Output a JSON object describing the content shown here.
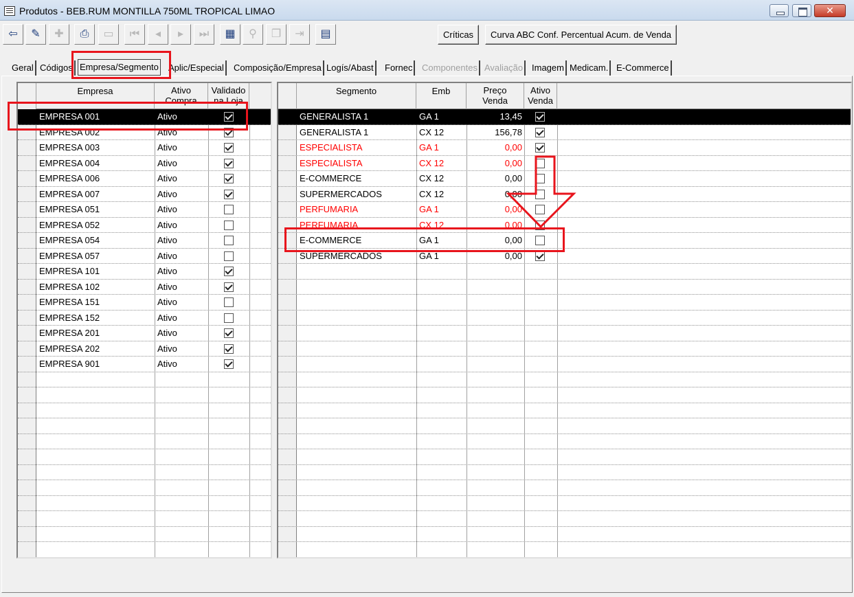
{
  "window": {
    "title": "Produtos - BEB.RUM MONTILLA 750ML TROPICAL LIMAO",
    "close_glyph": "✕"
  },
  "toolbar": {
    "icons": [
      {
        "name": "exit-icon",
        "glyph": "⇦",
        "enabled": true
      },
      {
        "name": "edit-icon",
        "glyph": "✎",
        "enabled": true
      },
      {
        "name": "new-record-icon",
        "glyph": "✚",
        "enabled": false
      },
      {
        "name": "print-icon",
        "glyph": "⎙",
        "enabled": true
      },
      {
        "name": "delete-icon",
        "glyph": "▭",
        "enabled": false
      },
      {
        "name": "first-record-icon",
        "glyph": "⏮",
        "enabled": false
      },
      {
        "name": "prev-record-icon",
        "glyph": "◂",
        "enabled": false
      },
      {
        "name": "next-record-icon",
        "glyph": "▸",
        "enabled": false
      },
      {
        "name": "last-record-icon",
        "glyph": "⏭",
        "enabled": false
      },
      {
        "name": "list-view-icon",
        "glyph": "▦",
        "enabled": true
      },
      {
        "name": "find-icon",
        "glyph": "⚲",
        "enabled": false
      },
      {
        "name": "copy-icon",
        "glyph": "❐",
        "enabled": false
      },
      {
        "name": "export-icon",
        "glyph": "⇥",
        "enabled": false
      },
      {
        "name": "grid-config-icon",
        "glyph": "▤",
        "enabled": true
      }
    ],
    "criticas_label": "Críticas",
    "curva_label": "Curva ABC Conf. Percentual Acum. de Venda"
  },
  "tabs": [
    {
      "label": "Geral",
      "state": "normal"
    },
    {
      "label": "Códigos",
      "state": "normal"
    },
    {
      "label": "Empresa/Segmento",
      "state": "active"
    },
    {
      "label": "Aplic/Especial",
      "state": "normal"
    },
    {
      "label": "Composição/Empresa",
      "state": "normal"
    },
    {
      "label": "Logís/Abast",
      "state": "normal"
    },
    {
      "label": "Fornec",
      "state": "normal"
    },
    {
      "label": "Componentes",
      "state": "disabled"
    },
    {
      "label": "Avaliação",
      "state": "disabled"
    },
    {
      "label": "Imagem",
      "state": "normal"
    },
    {
      "label": "Medicam.",
      "state": "normal"
    },
    {
      "label": "E-Commerce",
      "state": "normal"
    }
  ],
  "empresa_grid": {
    "headers": {
      "empresa": "Empresa",
      "ativo_compra": "Ativo\nCompra",
      "validado": "Validado\nna Loja"
    },
    "rows": [
      {
        "empresa": "EMPRESA 001",
        "ativo": "Ativo",
        "validado": true,
        "selected": true
      },
      {
        "empresa": "EMPRESA 002",
        "ativo": "Ativo",
        "validado": true
      },
      {
        "empresa": "EMPRESA 003",
        "ativo": "Ativo",
        "validado": true
      },
      {
        "empresa": "EMPRESA 004",
        "ativo": "Ativo",
        "validado": true
      },
      {
        "empresa": "EMPRESA 006",
        "ativo": "Ativo",
        "validado": true
      },
      {
        "empresa": "EMPRESA 007",
        "ativo": "Ativo",
        "validado": true
      },
      {
        "empresa": "EMPRESA 051",
        "ativo": "Ativo",
        "validado": false
      },
      {
        "empresa": "EMPRESA 052",
        "ativo": "Ativo",
        "validado": false
      },
      {
        "empresa": "EMPRESA 054",
        "ativo": "Ativo",
        "validado": false
      },
      {
        "empresa": "EMPRESA 057",
        "ativo": "Ativo",
        "validado": false
      },
      {
        "empresa": "EMPRESA 101",
        "ativo": "Ativo",
        "validado": true
      },
      {
        "empresa": "EMPRESA 102",
        "ativo": "Ativo",
        "validado": true
      },
      {
        "empresa": "EMPRESA 151",
        "ativo": "Ativo",
        "validado": false
      },
      {
        "empresa": "EMPRESA 152",
        "ativo": "Ativo",
        "validado": false
      },
      {
        "empresa": "EMPRESA 201",
        "ativo": "Ativo",
        "validado": true
      },
      {
        "empresa": "EMPRESA 202",
        "ativo": "Ativo",
        "validado": true
      },
      {
        "empresa": "EMPRESA 901",
        "ativo": "Ativo",
        "validado": true
      }
    ]
  },
  "segmento_grid": {
    "headers": {
      "segmento": "Segmento",
      "emb": "Emb",
      "preco": "Preço\nVenda",
      "ativo_venda": "Ativo\nVenda"
    },
    "rows": [
      {
        "segmento": "GENERALISTA 1",
        "emb": "GA 1",
        "preco": "13,45",
        "ativo": true,
        "selected": true,
        "red": false
      },
      {
        "segmento": "GENERALISTA 1",
        "emb": "CX 12",
        "preco": "156,78",
        "ativo": true,
        "red": false
      },
      {
        "segmento": "ESPECIALISTA",
        "emb": "GA 1",
        "preco": "0,00",
        "ativo": true,
        "red": true
      },
      {
        "segmento": "ESPECIALISTA",
        "emb": "CX 12",
        "preco": "0,00",
        "ativo": false,
        "red": true
      },
      {
        "segmento": "E-COMMERCE",
        "emb": "CX 12",
        "preco": "0,00",
        "ativo": false,
        "red": false
      },
      {
        "segmento": "SUPERMERCADOS",
        "emb": "CX 12",
        "preco": "0,00",
        "ativo": false,
        "red": false
      },
      {
        "segmento": "PERFUMARIA",
        "emb": "GA 1",
        "preco": "0,00",
        "ativo": false,
        "red": true
      },
      {
        "segmento": "PERFUMARIA",
        "emb": "CX 12",
        "preco": "0,00",
        "ativo": false,
        "red": true
      },
      {
        "segmento": "E-COMMERCE",
        "emb": "GA 1",
        "preco": "0,00",
        "ativo": false,
        "red": false
      },
      {
        "segmento": "SUPERMERCADOS",
        "emb": "GA 1",
        "preco": "0,00",
        "ativo": true,
        "red": false
      }
    ]
  },
  "colors": {
    "annotation": "#e8141c",
    "error_text": "#ff0000",
    "selection": "#000000"
  }
}
